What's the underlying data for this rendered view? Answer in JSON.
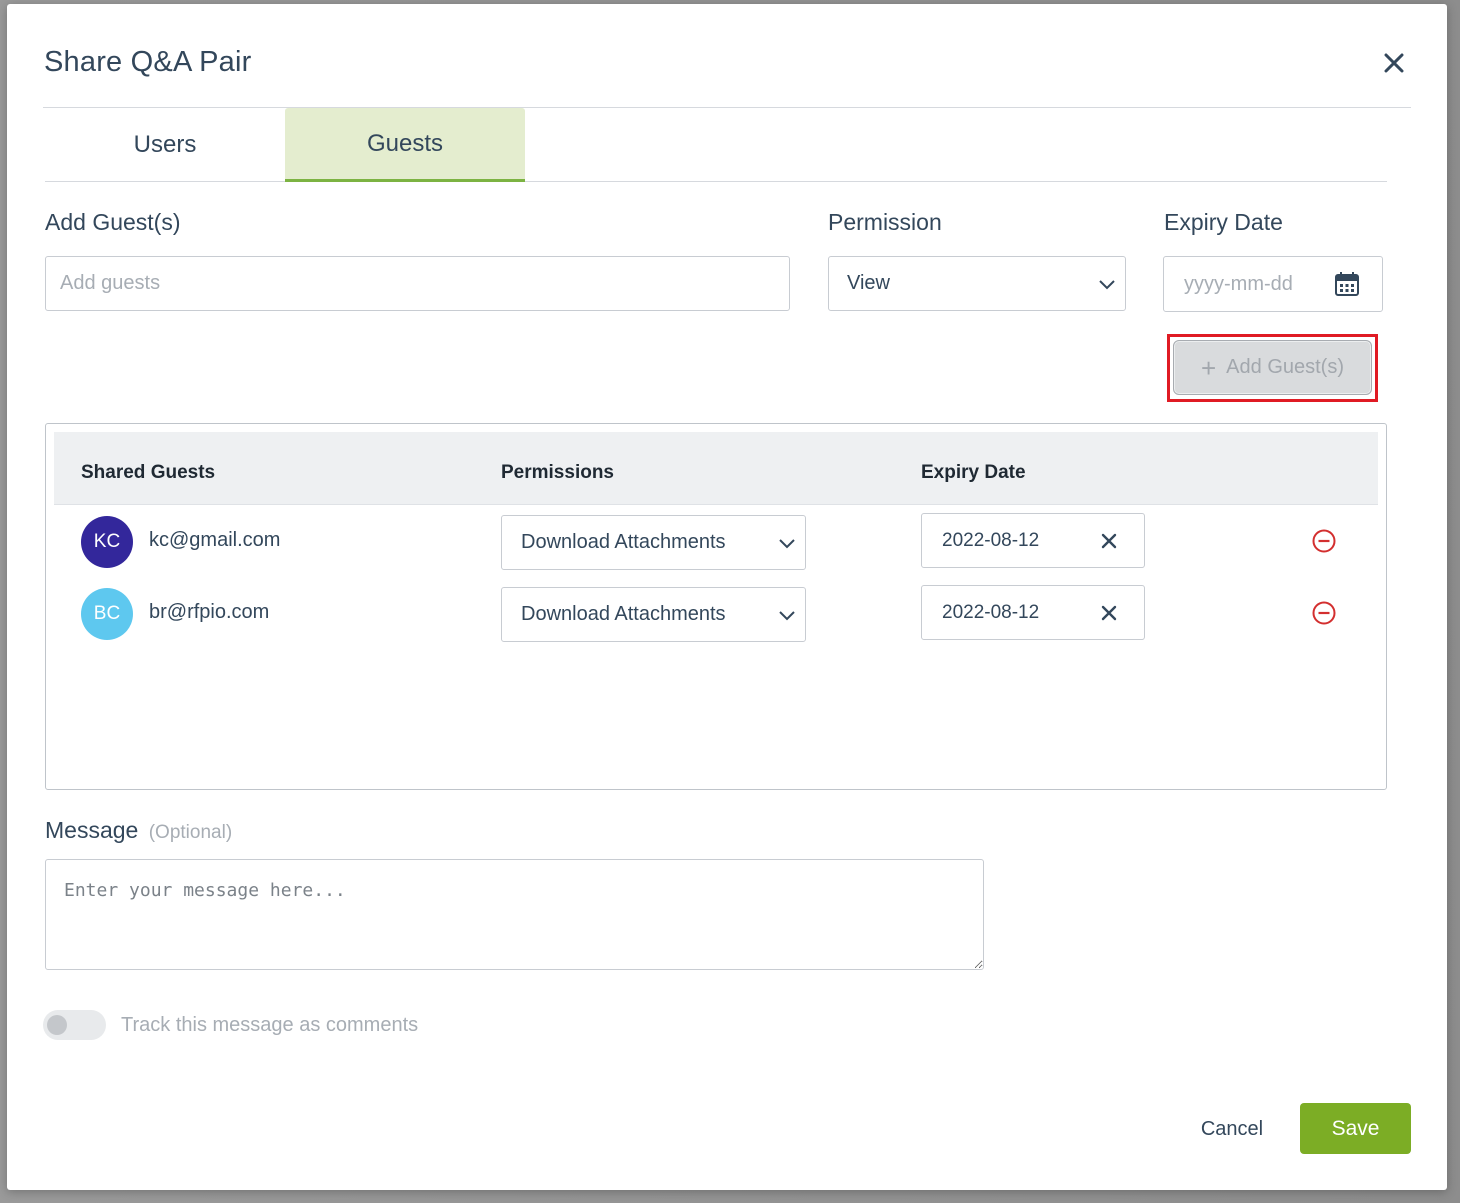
{
  "modal": {
    "title": "Share Q&A Pair"
  },
  "tabs": [
    {
      "label": "Users",
      "active": false
    },
    {
      "label": "Guests",
      "active": true
    }
  ],
  "form": {
    "add_guests_label": "Add Guest(s)",
    "add_guests_placeholder": "Add guests",
    "permission_label": "Permission",
    "permission_value": "View",
    "expiry_label": "Expiry Date",
    "expiry_placeholder": "yyyy-mm-dd",
    "add_button_label": "Add Guest(s)"
  },
  "table": {
    "headers": [
      "Shared Guests",
      "Permissions",
      "Expiry Date"
    ],
    "rows": [
      {
        "initials": "KC",
        "email": "kc@gmail.com",
        "permission": "Download Attachments",
        "expiry": "2022-08-12",
        "avatar_color": "#33279b"
      },
      {
        "initials": "BC",
        "email": "br@rfpio.com",
        "permission": "Download Attachments",
        "expiry": "2022-08-12",
        "avatar_color": "#5ec8ef"
      }
    ]
  },
  "message": {
    "label": "Message",
    "optional": "(Optional)",
    "placeholder": "Enter your message here..."
  },
  "track": {
    "label": "Track this message as comments",
    "enabled": false
  },
  "footer": {
    "cancel_label": "Cancel",
    "save_label": "Save"
  },
  "colors": {
    "accent": "#7cad25",
    "tab_active_bg": "#e4edcf",
    "remove": "#d32f2f",
    "highlight": "#e01b24"
  }
}
